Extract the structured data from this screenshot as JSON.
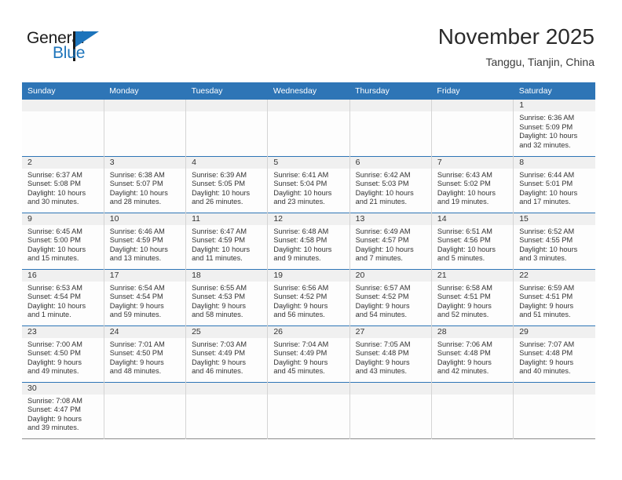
{
  "brand": {
    "name_part1": "General",
    "name_part2": "Blue",
    "flag_icon": "triangle-flag-icon"
  },
  "header": {
    "month_title": "November 2025",
    "location": "Tanggu, Tianjin, China"
  },
  "theme": {
    "header_blue": "#2e75b6",
    "band_gray": "#f0f0f0",
    "brand_blue": "#1d74bb",
    "text": "#333333"
  },
  "calendar": {
    "weekday_headers": [
      "Sunday",
      "Monday",
      "Tuesday",
      "Wednesday",
      "Thursday",
      "Friday",
      "Saturday"
    ],
    "weeks": [
      [
        {
          "day": "",
          "empty": true
        },
        {
          "day": "",
          "empty": true
        },
        {
          "day": "",
          "empty": true
        },
        {
          "day": "",
          "empty": true
        },
        {
          "day": "",
          "empty": true
        },
        {
          "day": "",
          "empty": true
        },
        {
          "day": "1",
          "sunrise": "Sunrise: 6:36 AM",
          "sunset": "Sunset: 5:09 PM",
          "daylight_line1": "Daylight: 10 hours",
          "daylight_line2": "and 32 minutes."
        }
      ],
      [
        {
          "day": "2",
          "sunrise": "Sunrise: 6:37 AM",
          "sunset": "Sunset: 5:08 PM",
          "daylight_line1": "Daylight: 10 hours",
          "daylight_line2": "and 30 minutes."
        },
        {
          "day": "3",
          "sunrise": "Sunrise: 6:38 AM",
          "sunset": "Sunset: 5:07 PM",
          "daylight_line1": "Daylight: 10 hours",
          "daylight_line2": "and 28 minutes."
        },
        {
          "day": "4",
          "sunrise": "Sunrise: 6:39 AM",
          "sunset": "Sunset: 5:05 PM",
          "daylight_line1": "Daylight: 10 hours",
          "daylight_line2": "and 26 minutes."
        },
        {
          "day": "5",
          "sunrise": "Sunrise: 6:41 AM",
          "sunset": "Sunset: 5:04 PM",
          "daylight_line1": "Daylight: 10 hours",
          "daylight_line2": "and 23 minutes."
        },
        {
          "day": "6",
          "sunrise": "Sunrise: 6:42 AM",
          "sunset": "Sunset: 5:03 PM",
          "daylight_line1": "Daylight: 10 hours",
          "daylight_line2": "and 21 minutes."
        },
        {
          "day": "7",
          "sunrise": "Sunrise: 6:43 AM",
          "sunset": "Sunset: 5:02 PM",
          "daylight_line1": "Daylight: 10 hours",
          "daylight_line2": "and 19 minutes."
        },
        {
          "day": "8",
          "sunrise": "Sunrise: 6:44 AM",
          "sunset": "Sunset: 5:01 PM",
          "daylight_line1": "Daylight: 10 hours",
          "daylight_line2": "and 17 minutes."
        }
      ],
      [
        {
          "day": "9",
          "sunrise": "Sunrise: 6:45 AM",
          "sunset": "Sunset: 5:00 PM",
          "daylight_line1": "Daylight: 10 hours",
          "daylight_line2": "and 15 minutes."
        },
        {
          "day": "10",
          "sunrise": "Sunrise: 6:46 AM",
          "sunset": "Sunset: 4:59 PM",
          "daylight_line1": "Daylight: 10 hours",
          "daylight_line2": "and 13 minutes."
        },
        {
          "day": "11",
          "sunrise": "Sunrise: 6:47 AM",
          "sunset": "Sunset: 4:59 PM",
          "daylight_line1": "Daylight: 10 hours",
          "daylight_line2": "and 11 minutes."
        },
        {
          "day": "12",
          "sunrise": "Sunrise: 6:48 AM",
          "sunset": "Sunset: 4:58 PM",
          "daylight_line1": "Daylight: 10 hours",
          "daylight_line2": "and 9 minutes."
        },
        {
          "day": "13",
          "sunrise": "Sunrise: 6:49 AM",
          "sunset": "Sunset: 4:57 PM",
          "daylight_line1": "Daylight: 10 hours",
          "daylight_line2": "and 7 minutes."
        },
        {
          "day": "14",
          "sunrise": "Sunrise: 6:51 AM",
          "sunset": "Sunset: 4:56 PM",
          "daylight_line1": "Daylight: 10 hours",
          "daylight_line2": "and 5 minutes."
        },
        {
          "day": "15",
          "sunrise": "Sunrise: 6:52 AM",
          "sunset": "Sunset: 4:55 PM",
          "daylight_line1": "Daylight: 10 hours",
          "daylight_line2": "and 3 minutes."
        }
      ],
      [
        {
          "day": "16",
          "sunrise": "Sunrise: 6:53 AM",
          "sunset": "Sunset: 4:54 PM",
          "daylight_line1": "Daylight: 10 hours",
          "daylight_line2": "and 1 minute."
        },
        {
          "day": "17",
          "sunrise": "Sunrise: 6:54 AM",
          "sunset": "Sunset: 4:54 PM",
          "daylight_line1": "Daylight: 9 hours",
          "daylight_line2": "and 59 minutes."
        },
        {
          "day": "18",
          "sunrise": "Sunrise: 6:55 AM",
          "sunset": "Sunset: 4:53 PM",
          "daylight_line1": "Daylight: 9 hours",
          "daylight_line2": "and 58 minutes."
        },
        {
          "day": "19",
          "sunrise": "Sunrise: 6:56 AM",
          "sunset": "Sunset: 4:52 PM",
          "daylight_line1": "Daylight: 9 hours",
          "daylight_line2": "and 56 minutes."
        },
        {
          "day": "20",
          "sunrise": "Sunrise: 6:57 AM",
          "sunset": "Sunset: 4:52 PM",
          "daylight_line1": "Daylight: 9 hours",
          "daylight_line2": "and 54 minutes."
        },
        {
          "day": "21",
          "sunrise": "Sunrise: 6:58 AM",
          "sunset": "Sunset: 4:51 PM",
          "daylight_line1": "Daylight: 9 hours",
          "daylight_line2": "and 52 minutes."
        },
        {
          "day": "22",
          "sunrise": "Sunrise: 6:59 AM",
          "sunset": "Sunset: 4:51 PM",
          "daylight_line1": "Daylight: 9 hours",
          "daylight_line2": "and 51 minutes."
        }
      ],
      [
        {
          "day": "23",
          "sunrise": "Sunrise: 7:00 AM",
          "sunset": "Sunset: 4:50 PM",
          "daylight_line1": "Daylight: 9 hours",
          "daylight_line2": "and 49 minutes."
        },
        {
          "day": "24",
          "sunrise": "Sunrise: 7:01 AM",
          "sunset": "Sunset: 4:50 PM",
          "daylight_line1": "Daylight: 9 hours",
          "daylight_line2": "and 48 minutes."
        },
        {
          "day": "25",
          "sunrise": "Sunrise: 7:03 AM",
          "sunset": "Sunset: 4:49 PM",
          "daylight_line1": "Daylight: 9 hours",
          "daylight_line2": "and 46 minutes."
        },
        {
          "day": "26",
          "sunrise": "Sunrise: 7:04 AM",
          "sunset": "Sunset: 4:49 PM",
          "daylight_line1": "Daylight: 9 hours",
          "daylight_line2": "and 45 minutes."
        },
        {
          "day": "27",
          "sunrise": "Sunrise: 7:05 AM",
          "sunset": "Sunset: 4:48 PM",
          "daylight_line1": "Daylight: 9 hours",
          "daylight_line2": "and 43 minutes."
        },
        {
          "day": "28",
          "sunrise": "Sunrise: 7:06 AM",
          "sunset": "Sunset: 4:48 PM",
          "daylight_line1": "Daylight: 9 hours",
          "daylight_line2": "and 42 minutes."
        },
        {
          "day": "29",
          "sunrise": "Sunrise: 7:07 AM",
          "sunset": "Sunset: 4:48 PM",
          "daylight_line1": "Daylight: 9 hours",
          "daylight_line2": "and 40 minutes."
        }
      ],
      [
        {
          "day": "30",
          "sunrise": "Sunrise: 7:08 AM",
          "sunset": "Sunset: 4:47 PM",
          "daylight_line1": "Daylight: 9 hours",
          "daylight_line2": "and 39 minutes."
        },
        {
          "day": "",
          "empty": true
        },
        {
          "day": "",
          "empty": true
        },
        {
          "day": "",
          "empty": true
        },
        {
          "day": "",
          "empty": true
        },
        {
          "day": "",
          "empty": true
        },
        {
          "day": "",
          "empty": true
        }
      ]
    ]
  }
}
